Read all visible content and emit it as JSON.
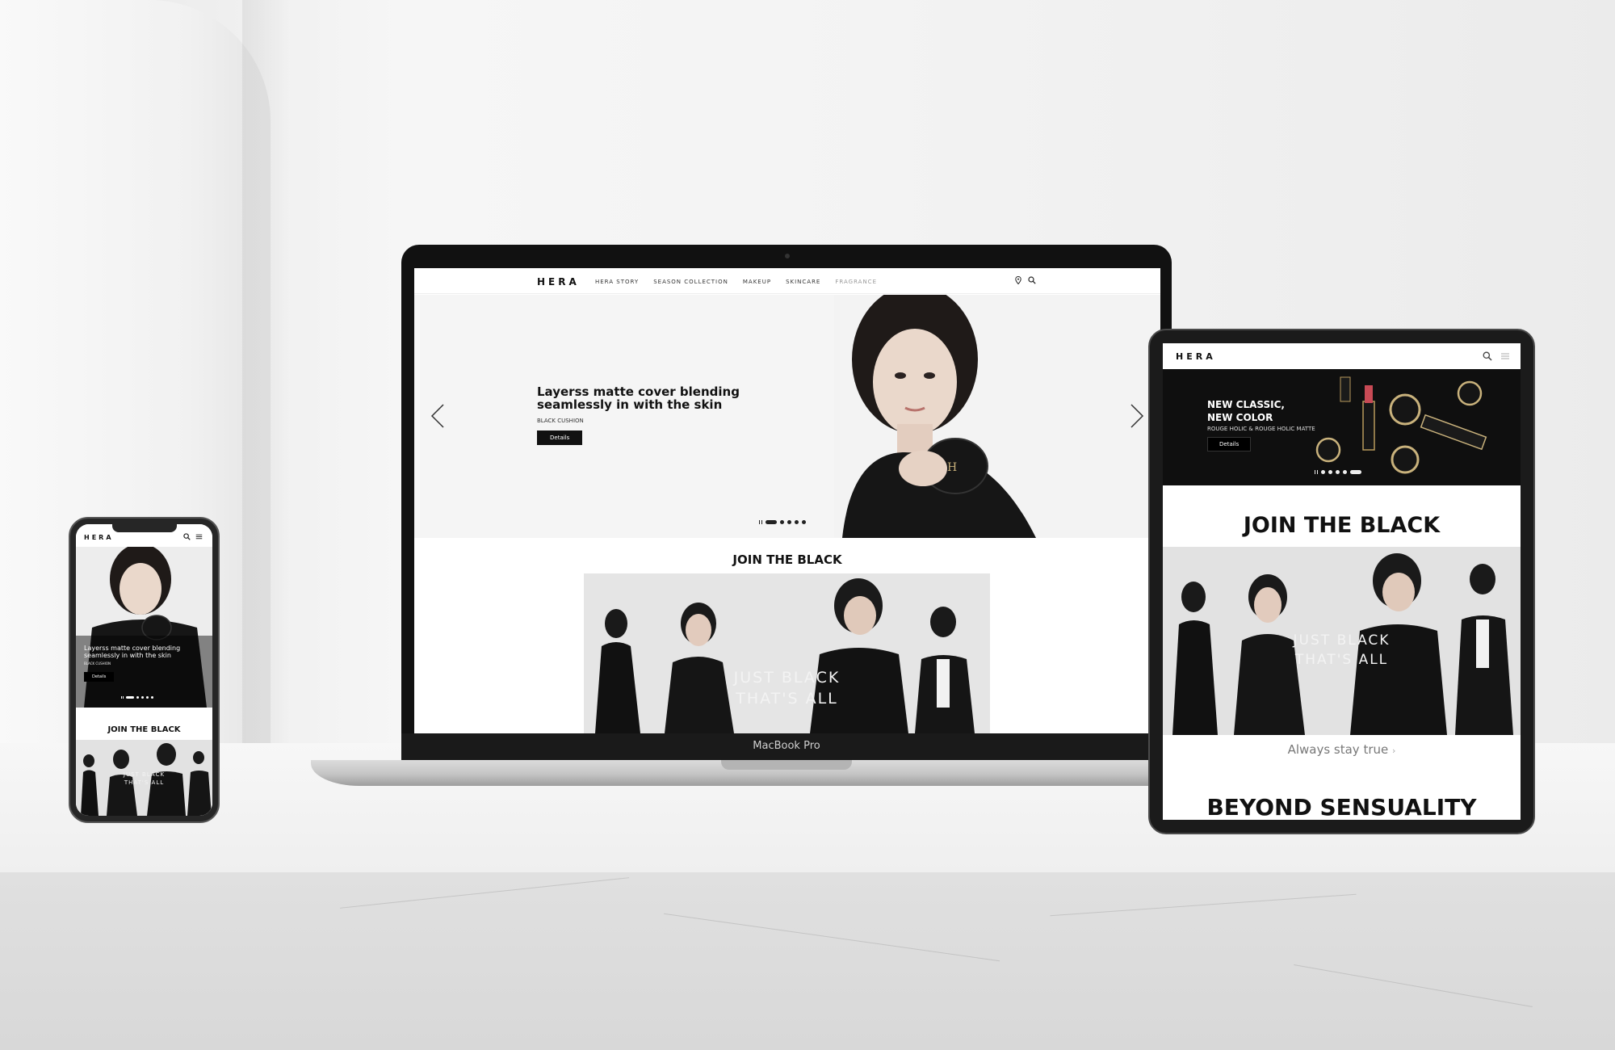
{
  "brand": "HERA",
  "desktop": {
    "nav": [
      "HERA STORY",
      "SEASON COLLECTION",
      "MAKEUP",
      "SKINCARE",
      "FRAGRANCE"
    ],
    "hero": {
      "headline": "Layerss matte cover blending seamlessly in with the skin",
      "product": "BLACK CUSHION",
      "button": "Details"
    },
    "section_title": "JOIN THE BLACK",
    "band_line1": "JUST BLACK",
    "band_line2": "THAT'S ALL",
    "device_label": "MacBook Pro",
    "slides": {
      "count": 6,
      "active": 2
    }
  },
  "tablet": {
    "banner": {
      "line1": "NEW CLASSIC,",
      "line2": "NEW COLOR",
      "sub": "ROUGE HOLIC & ROUGE HOLIC MATTE",
      "button": "Details"
    },
    "section_title": "JOIN THE BLACK",
    "band_line1": "JUST BLACK",
    "band_line2": "THAT'S ALL",
    "link": "Always stay true",
    "section_title_2": "BEYOND SENSUALITY",
    "slides": {
      "count": 6,
      "active": 6
    }
  },
  "mobile": {
    "hero": {
      "headline": "Layerss matte cover blending seamlessly in with the skin",
      "product": "BLACK CUSHION",
      "button": "Details"
    },
    "section_title": "JOIN THE BLACK",
    "band_line1": "JUST BLACK",
    "band_line2": "THAT'S ALL",
    "slides": {
      "count": 6,
      "active": 2
    }
  },
  "icons": [
    "location-pin-icon",
    "search-icon",
    "menu-icon",
    "chevron-left-icon",
    "chevron-right-icon"
  ],
  "colors": {
    "brand_black": "#111111",
    "background": "#ffffff",
    "hero_bg": "#f5f5f5"
  }
}
